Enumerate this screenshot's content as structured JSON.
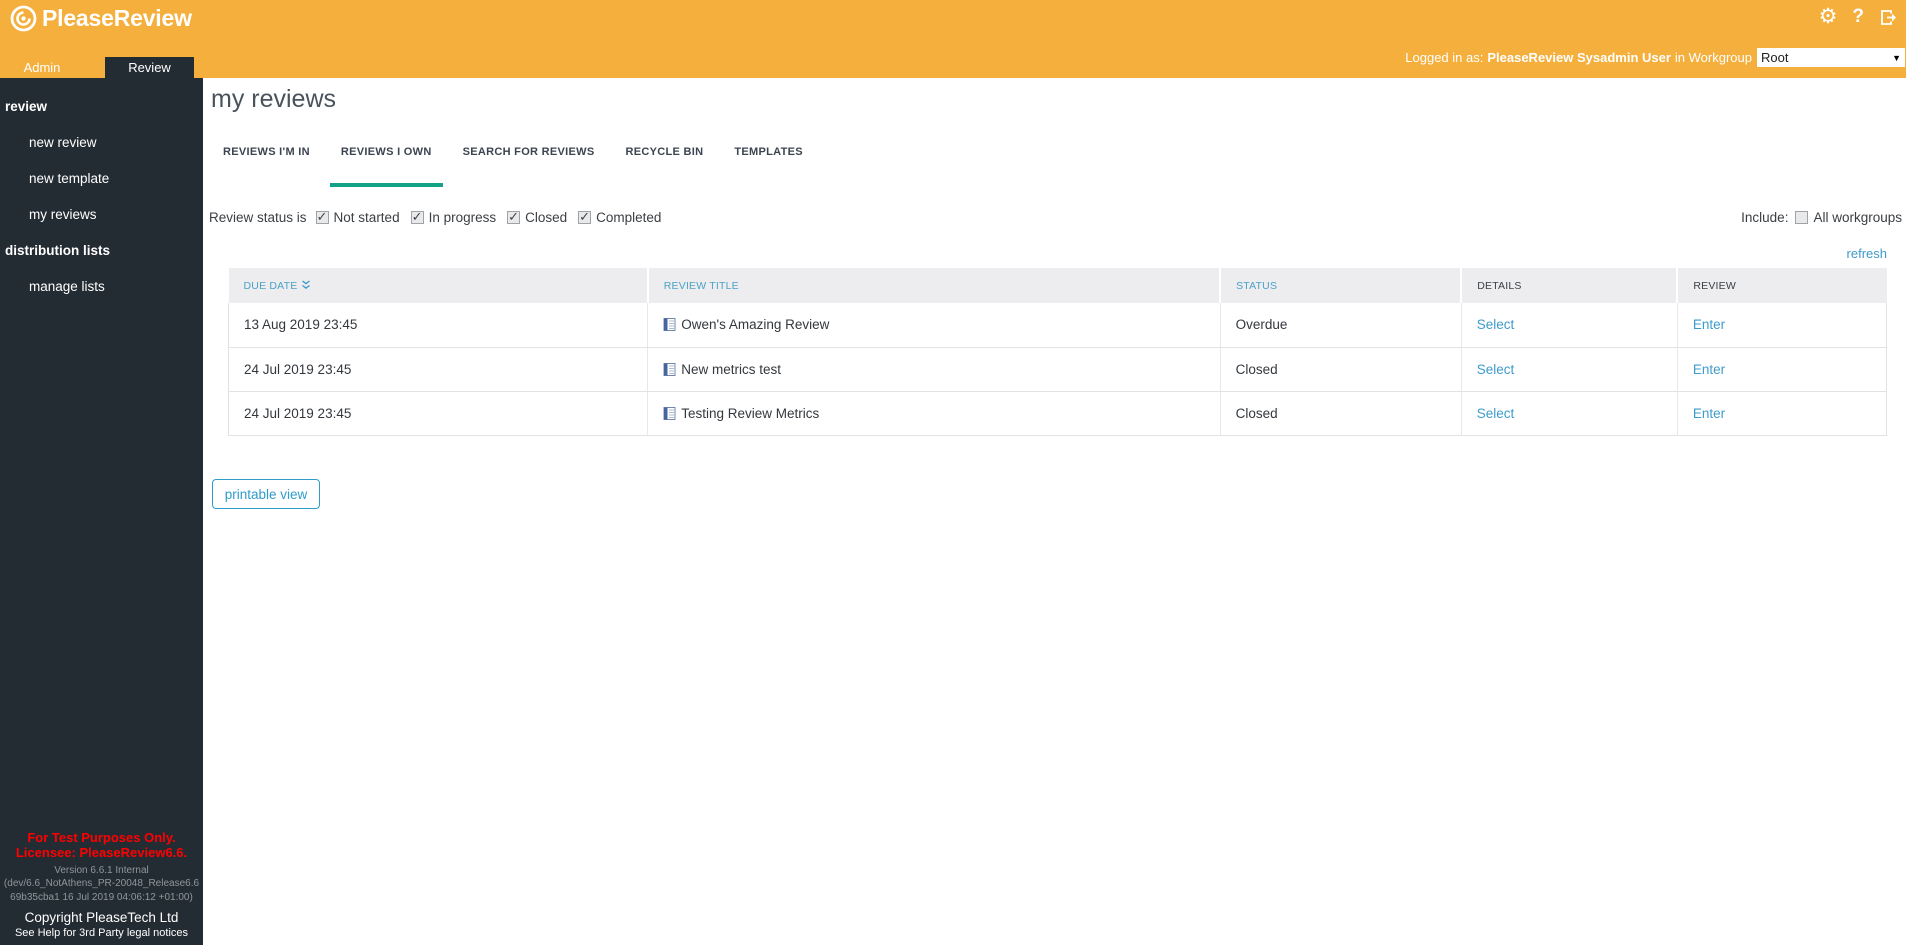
{
  "brand": "PleaseReview",
  "header": {
    "logged_in_prefix": "Logged in as:",
    "user": "PleaseReview Sysadmin User",
    "workgroup_label": "in Workgroup",
    "workgroup_value": "Root"
  },
  "nav_tabs": {
    "admin": "Admin",
    "review": "Review"
  },
  "sidebar": {
    "section1_title": "review",
    "section1_items": {
      "0": "new review",
      "1": "new template",
      "2": "my reviews"
    },
    "section2_title": "distribution lists",
    "section2_items": {
      "0": "manage lists"
    },
    "footer": {
      "red1": "For Test Purposes Only.",
      "red2": "Licensee: PleaseReview6.6.",
      "ver1": "Version 6.6.1 Internal",
      "ver2": "(dev/6.6_NotAthens_PR-20048_Release6.6",
      "ver3": "69b35cba1 16 Jul 2019 04:06:12 +01:00)",
      "copyright": "Copyright PleaseTech Ltd",
      "legal": "See Help for 3rd Party legal notices"
    }
  },
  "main": {
    "title": "my reviews",
    "tabs": {
      "0": "REVIEWS I'M IN",
      "1": "REVIEWS I OWN",
      "2": "SEARCH FOR REVIEWS",
      "3": "RECYCLE BIN",
      "4": "TEMPLATES"
    },
    "filter": {
      "label": "Review status is",
      "cb0": {
        "label": "Not started",
        "checked": true
      },
      "cb1": {
        "label": "In progress",
        "checked": true
      },
      "cb2": {
        "label": "Closed",
        "checked": true
      },
      "cb3": {
        "label": "Completed",
        "checked": true
      }
    },
    "include": {
      "label": "Include:",
      "cb": {
        "label": "All workgroups",
        "checked": false
      }
    },
    "refresh": "refresh",
    "table": {
      "headers": {
        "due": "DUE DATE",
        "title": "REVIEW TITLE",
        "status": "STATUS",
        "details": "DETAILS",
        "review": "REVIEW"
      },
      "rows": {
        "0": {
          "due": "13 Aug 2019 23:45",
          "title": "Owen's Amazing Review",
          "status": "Overdue",
          "details": "Select",
          "review": "Enter"
        },
        "1": {
          "due": "24 Jul 2019 23:45",
          "title": "New metrics test",
          "status": "Closed",
          "details": "Select",
          "review": "Enter"
        },
        "2": {
          "due": "24 Jul 2019 23:45",
          "title": "Testing Review Metrics",
          "status": "Closed",
          "details": "Select",
          "review": "Enter"
        }
      }
    },
    "printable": "printable view"
  },
  "colors": {
    "accent_orange": "#F4AF3D",
    "dark": "#242C33",
    "teal": "#13A286",
    "link_blue": "#3E9CCB",
    "red": "#FF0000"
  }
}
